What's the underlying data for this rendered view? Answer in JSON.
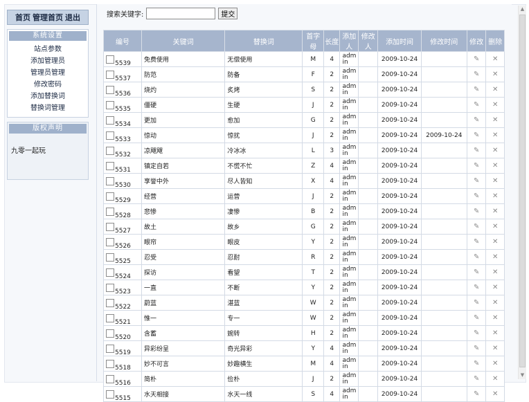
{
  "topnav": {
    "home": "首页",
    "admin_home": "管理首页",
    "logout": "退出"
  },
  "settings_box": {
    "title": "系统设置",
    "items": [
      "站点参数",
      "添加管理员",
      "管理员管理",
      "修改密码",
      "添加替换词",
      "替换词管理"
    ]
  },
  "copyright_box": {
    "title": "版权声明",
    "text": "九零一起玩"
  },
  "search": {
    "label": "搜索关键字:",
    "value": "",
    "button": "提交"
  },
  "table": {
    "headers": [
      "编号",
      "关键词",
      "替换词",
      "首字母",
      "长度",
      "添加人",
      "修改人",
      "添加时间",
      "修改时间",
      "修改",
      "删除"
    ],
    "rows": [
      {
        "id": "5539",
        "keyword": "免费使用",
        "replace": "无偿使用",
        "initial": "M",
        "length": "4",
        "added_by": "admin",
        "modified_by": "",
        "added_time": "2009-10-24",
        "modified_time": ""
      },
      {
        "id": "5537",
        "keyword": "防范",
        "replace": "防备",
        "initial": "F",
        "length": "2",
        "added_by": "admin",
        "modified_by": "",
        "added_time": "2009-10-24",
        "modified_time": ""
      },
      {
        "id": "5536",
        "keyword": "烧灼",
        "replace": "炙烤",
        "initial": "S",
        "length": "2",
        "added_by": "admin",
        "modified_by": "",
        "added_time": "2009-10-24",
        "modified_time": ""
      },
      {
        "id": "5535",
        "keyword": "僵硬",
        "replace": "生硬",
        "initial": "J",
        "length": "2",
        "added_by": "admin",
        "modified_by": "",
        "added_time": "2009-10-24",
        "modified_time": ""
      },
      {
        "id": "5534",
        "keyword": "更加",
        "replace": "愈加",
        "initial": "G",
        "length": "2",
        "added_by": "admin",
        "modified_by": "",
        "added_time": "2009-10-24",
        "modified_time": ""
      },
      {
        "id": "5533",
        "keyword": "惊动",
        "replace": "惊扰",
        "initial": "J",
        "length": "2",
        "added_by": "admin",
        "modified_by": "",
        "added_time": "2009-10-24",
        "modified_time": "2009-10-24"
      },
      {
        "id": "5532",
        "keyword": "凉飕飕",
        "replace": "冷冰冰",
        "initial": "L",
        "length": "3",
        "added_by": "admin",
        "modified_by": "",
        "added_time": "2009-10-24",
        "modified_time": ""
      },
      {
        "id": "5531",
        "keyword": "镇定自若",
        "replace": "不慌不忙",
        "initial": "Z",
        "length": "4",
        "added_by": "admin",
        "modified_by": "",
        "added_time": "2009-10-24",
        "modified_time": ""
      },
      {
        "id": "5530",
        "keyword": "享誉中外",
        "replace": "尽人皆知",
        "initial": "X",
        "length": "4",
        "added_by": "admin",
        "modified_by": "",
        "added_time": "2009-10-24",
        "modified_time": ""
      },
      {
        "id": "5529",
        "keyword": "经营",
        "replace": "运营",
        "initial": "J",
        "length": "2",
        "added_by": "admin",
        "modified_by": "",
        "added_time": "2009-10-24",
        "modified_time": ""
      },
      {
        "id": "5528",
        "keyword": "悲惨",
        "replace": "凄惨",
        "initial": "B",
        "length": "2",
        "added_by": "admin",
        "modified_by": "",
        "added_time": "2009-10-24",
        "modified_time": ""
      },
      {
        "id": "5527",
        "keyword": "故土",
        "replace": "故乡",
        "initial": "G",
        "length": "2",
        "added_by": "admin",
        "modified_by": "",
        "added_time": "2009-10-24",
        "modified_time": ""
      },
      {
        "id": "5526",
        "keyword": "眼帘",
        "replace": "眼皮",
        "initial": "Y",
        "length": "2",
        "added_by": "admin",
        "modified_by": "",
        "added_time": "2009-10-24",
        "modified_time": ""
      },
      {
        "id": "5525",
        "keyword": "忍受",
        "replace": "忍耐",
        "initial": "R",
        "length": "2",
        "added_by": "admin",
        "modified_by": "",
        "added_time": "2009-10-24",
        "modified_time": ""
      },
      {
        "id": "5524",
        "keyword": "探访",
        "replace": "看望",
        "initial": "T",
        "length": "2",
        "added_by": "admin",
        "modified_by": "",
        "added_time": "2009-10-24",
        "modified_time": ""
      },
      {
        "id": "5523",
        "keyword": "一直",
        "replace": "不断",
        "initial": "Y",
        "length": "2",
        "added_by": "admin",
        "modified_by": "",
        "added_time": "2009-10-24",
        "modified_time": ""
      },
      {
        "id": "5522",
        "keyword": "蔚蓝",
        "replace": "湛蓝",
        "initial": "W",
        "length": "2",
        "added_by": "admin",
        "modified_by": "",
        "added_time": "2009-10-24",
        "modified_time": ""
      },
      {
        "id": "5521",
        "keyword": "惟一",
        "replace": "专一",
        "initial": "W",
        "length": "2",
        "added_by": "admin",
        "modified_by": "",
        "added_time": "2009-10-24",
        "modified_time": ""
      },
      {
        "id": "5520",
        "keyword": "含蓄",
        "replace": "婉转",
        "initial": "H",
        "length": "2",
        "added_by": "admin",
        "modified_by": "",
        "added_time": "2009-10-24",
        "modified_time": ""
      },
      {
        "id": "5519",
        "keyword": "异彩纷呈",
        "replace": "奇光异彩",
        "initial": "Y",
        "length": "4",
        "added_by": "admin",
        "modified_by": "",
        "added_time": "2009-10-24",
        "modified_time": ""
      },
      {
        "id": "5518",
        "keyword": "妙不可言",
        "replace": "妙趣横生",
        "initial": "M",
        "length": "4",
        "added_by": "admin",
        "modified_by": "",
        "added_time": "2009-10-24",
        "modified_time": ""
      },
      {
        "id": "5516",
        "keyword": "简朴",
        "replace": "俭朴",
        "initial": "J",
        "length": "2",
        "added_by": "admin",
        "modified_by": "",
        "added_time": "2009-10-24",
        "modified_time": ""
      },
      {
        "id": "5515",
        "keyword": "水天相接",
        "replace": "水天一线",
        "initial": "S",
        "length": "4",
        "added_by": "admin",
        "modified_by": "",
        "added_time": "2009-10-24",
        "modified_time": ""
      }
    ]
  },
  "icons": {
    "edit": "pencil-icon",
    "delete": "delete-x-icon"
  },
  "colors": {
    "header_bg": "#a6b5cd",
    "nav_bg": "#c6d3e4"
  }
}
